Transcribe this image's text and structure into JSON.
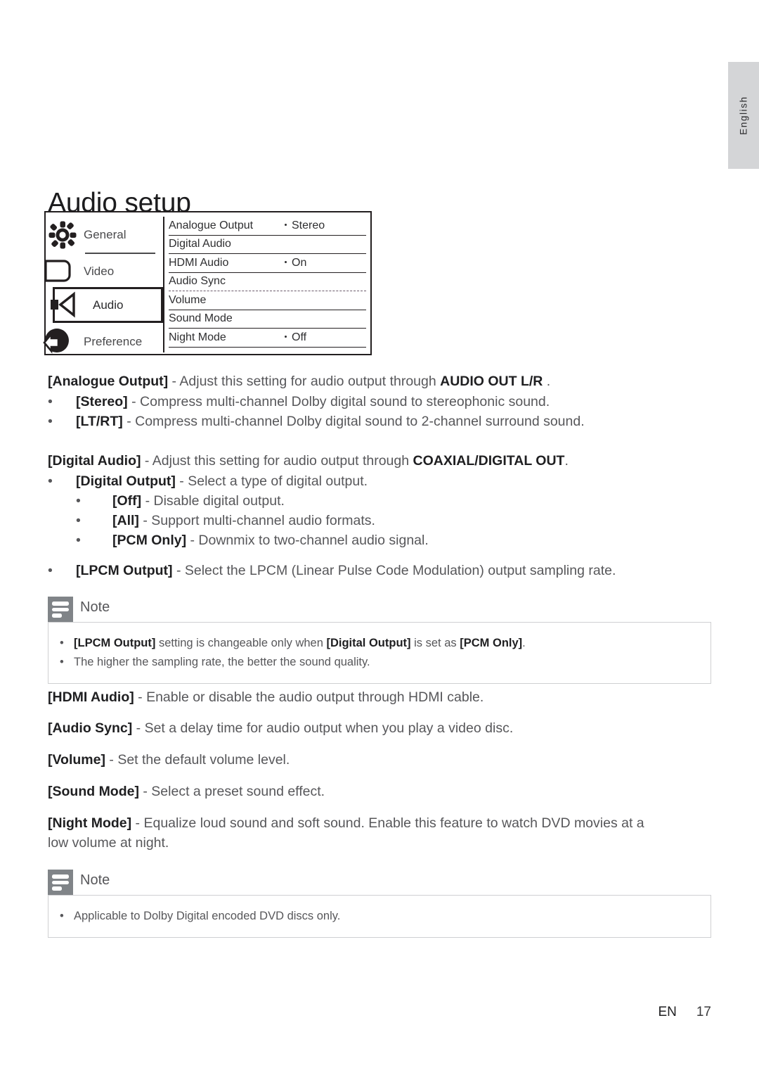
{
  "language_tab": {
    "label": "English"
  },
  "page_title": "Audio setup",
  "setup_menu": {
    "categories": [
      {
        "label": "General",
        "icon": "gear-icon",
        "selected": false
      },
      {
        "label": "Video",
        "icon": "monitor-icon",
        "selected": false
      },
      {
        "label": "Audio",
        "icon": "speaker-icon",
        "selected": true
      },
      {
        "label": "Preference",
        "icon": "preference-icon",
        "selected": false
      }
    ],
    "rows": [
      {
        "name": "Analogue Output",
        "value": "Stereo"
      },
      {
        "name": "Digital Audio",
        "value": ""
      },
      {
        "name": "HDMI Audio",
        "value": "On"
      },
      {
        "name": "Audio Sync",
        "value": ""
      },
      {
        "name": "Volume",
        "value": ""
      },
      {
        "name": "Sound Mode",
        "value": ""
      },
      {
        "name": "Night Mode",
        "value": "Off"
      }
    ]
  },
  "content": {
    "analogue_output": {
      "term": "[Analogue Output]",
      "desc_before": " - Adjust this setting for audio output through ",
      "emphasis": "AUDIO OUT L/R",
      "desc_after": " .",
      "options": [
        {
          "term": "[Stereo]",
          "desc": " - Compress multi-channel Dolby digital sound to stereophonic sound."
        },
        {
          "term": "[LT/RT]",
          "desc": " - Compress multi-channel Dolby digital sound to 2-channel surround sound."
        }
      ]
    },
    "digital_audio": {
      "term": "[Digital Audio]",
      "desc_before": " - Adjust this setting for audio output through ",
      "emphasis": "COAXIAL/DIGITAL OUT",
      "desc_after": ".",
      "digital_output": {
        "term": "[Digital Output]",
        "desc": " - Select a type of digital output.",
        "sub_options": [
          {
            "term": "[Off]",
            "desc": " - Disable digital output."
          },
          {
            "term": "[All]",
            "desc": " - Support multi-channel audio formats."
          },
          {
            "term": "[PCM Only]",
            "desc": " - Downmix to two-channel audio signal."
          }
        ]
      },
      "lpcm_output": {
        "term": "[LPCM Output]",
        "desc": " - Select the LPCM (Linear Pulse Code Modulation) output sampling rate."
      }
    },
    "hdmi_audio": {
      "term": "[HDMI Audio]",
      "desc": " - Enable or disable the audio output through HDMI cable."
    },
    "audio_sync": {
      "term": "[Audio Sync]",
      "desc": " - Set a delay time for audio output when you play a video disc."
    },
    "volume": {
      "term": "[Volume]",
      "desc": " - Set the default volume level."
    },
    "sound_mode": {
      "term": "[Sound Mode]",
      "desc": " - Select a preset sound effect."
    },
    "night_mode": {
      "term": "[Night Mode]",
      "desc_line1": " - Equalize loud sound and soft sound. Enable this feature to watch DVD movies at a",
      "desc_line2": "low volume at night."
    }
  },
  "note_1": {
    "title": "Note",
    "lines": [
      {
        "t1": "[LPCM Output]",
        "d1": " setting is changeable only when ",
        "t2": "[Digital Output]",
        "d2": " is set as ",
        "t3": "[PCM Only]",
        "d3": "."
      },
      {
        "d1": "The higher the sampling rate, the better the sound quality."
      }
    ]
  },
  "note_2": {
    "title": "Note",
    "lines": [
      {
        "d1": "Applicable to Dolby Digital encoded DVD discs only."
      }
    ]
  },
  "footer": {
    "lang_code": "EN",
    "page_number": "17"
  }
}
